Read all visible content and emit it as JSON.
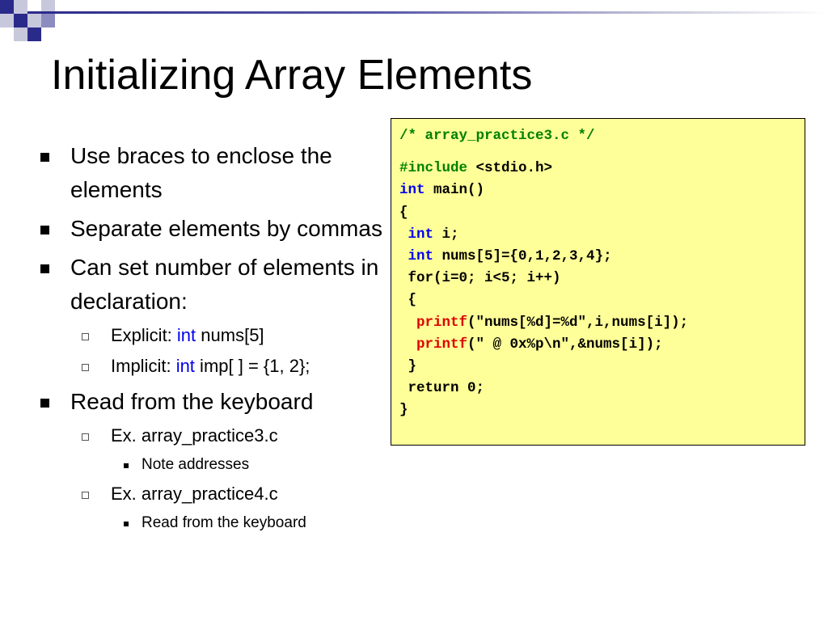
{
  "title": "Initializing Array Elements",
  "bullets": {
    "b1": "Use braces to enclose the elements",
    "b2": "Separate elements by commas",
    "b3": "Can set number of elements in declaration:",
    "b3_sub1": {
      "prefix": "Explicit: ",
      "keyword": "int",
      "rest": " nums[5]"
    },
    "b3_sub2": {
      "prefix": "Implicit: ",
      "keyword": "int",
      "rest": " imp[ ] = {1, 2};"
    },
    "b4": "Read from the keyboard",
    "b4_sub1": "Ex. array_practice3.c",
    "b4_sub1_sub": "Note addresses",
    "b4_sub2": "Ex. array_practice4.c",
    "b4_sub2_sub": "Read from the keyboard"
  },
  "code": {
    "comment": "/* array_practice3.c */",
    "include_kw": "#include",
    "include_rest": " <stdio.h>",
    "main_kw": "int",
    "main_rest": " main()",
    "open_brace": "{",
    "decl_i_kw": "int",
    "decl_i_rest": " i;",
    "decl_nums_kw": "int",
    "decl_nums_rest": " nums[5]={0,1,2,3,4};",
    "for_line": " for(i=0; i<5; i++)",
    "for_open": " {",
    "printf1_fn": "printf",
    "printf1_args": "(\"nums[%d]=%d\",i,nums[i]);",
    "printf2_fn": "printf",
    "printf2_args": "(\" @ 0x%p\\n\",&nums[i]);",
    "for_close": " }",
    "return_line": " return 0;",
    "close_brace": "}"
  },
  "colors": {
    "code_background": "#ffff99",
    "keyword": "#0000ee",
    "comment": "#008000",
    "function": "#dd0000",
    "accent_dark": "#2a2a8a",
    "accent_light": "#c8c8dc"
  }
}
